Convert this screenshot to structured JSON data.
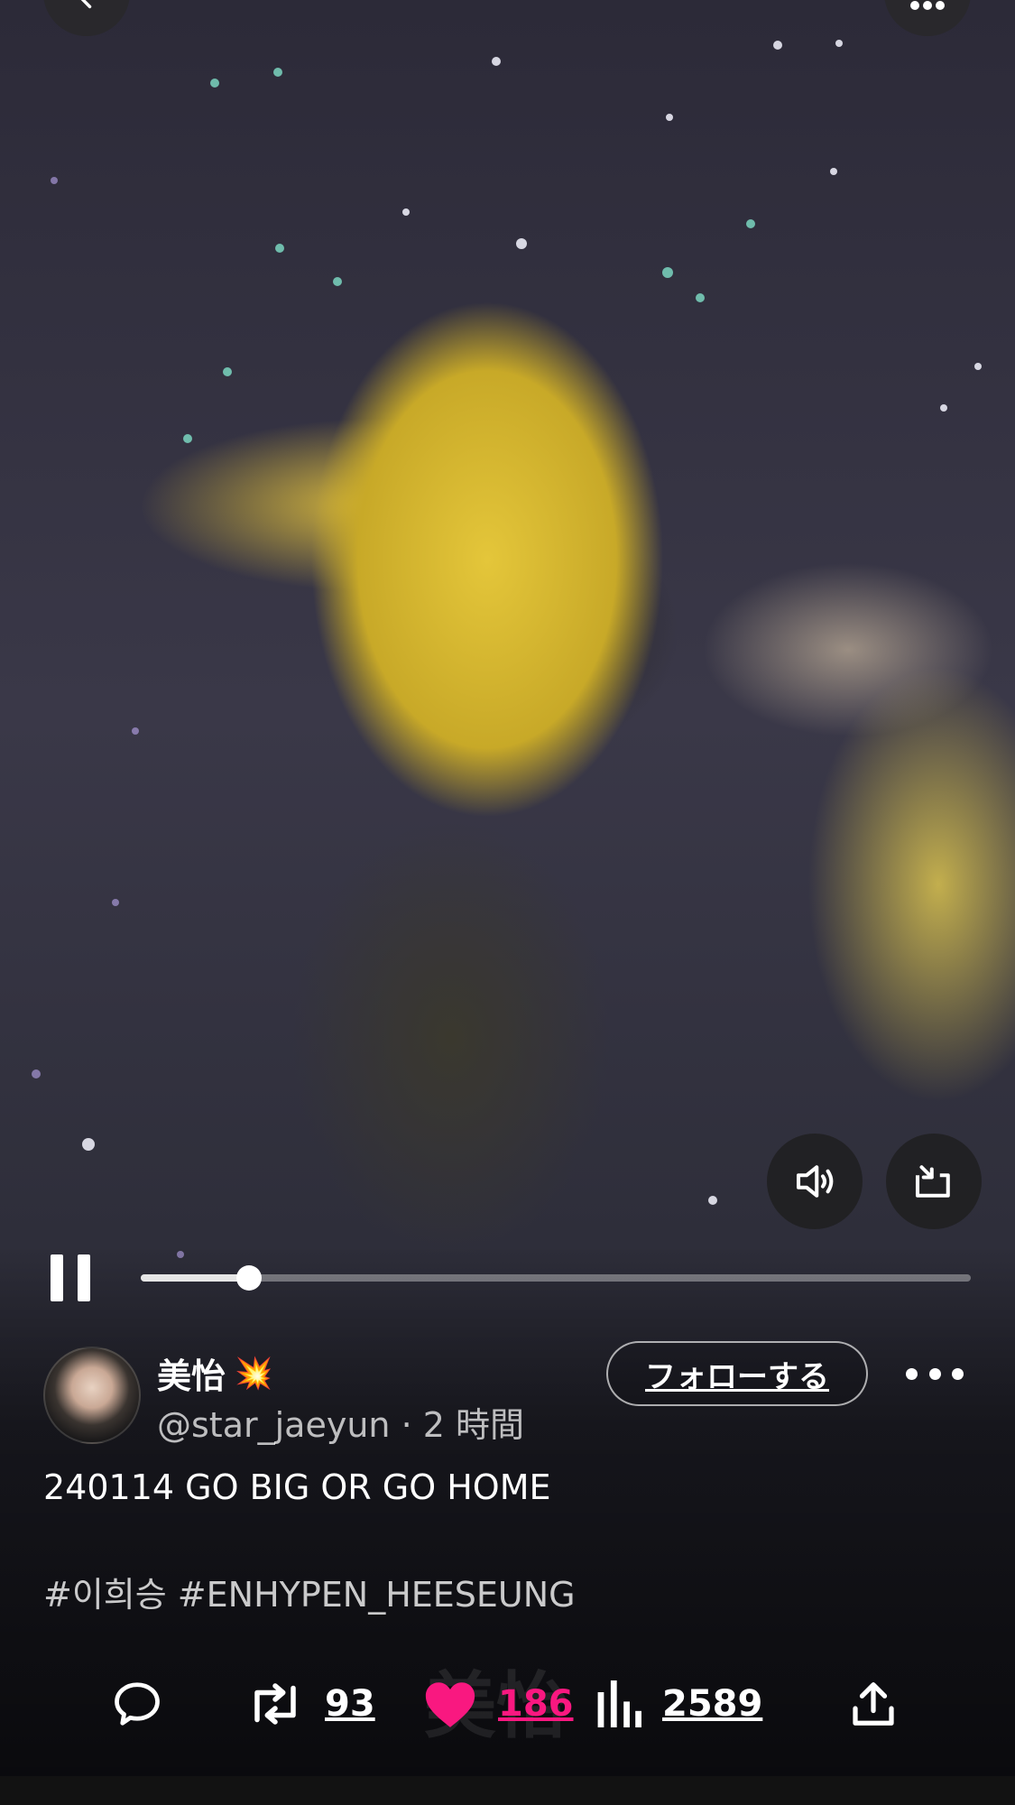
{
  "video": {
    "watermark": "美怡",
    "progress": 0.13
  },
  "controls": {
    "back_icon": "chevron-left-icon",
    "top_more_icon": "more-horizontal-icon",
    "sound_icon": "speaker-icon",
    "pip_icon": "picture-in-picture-icon",
    "pause_icon": "pause-icon"
  },
  "author": {
    "display_name": "美怡",
    "name_emoji": "💥",
    "handle_line": "@star_jaeyun · 2 時間",
    "follow_label": "フォローする"
  },
  "post": {
    "text": "240114 GO BIG OR GO HOME",
    "hashtags": "#이희승 #ENHYPEN_HEESEUNG"
  },
  "actions": {
    "reposts": "93",
    "likes": "186",
    "views": "2589"
  },
  "colors": {
    "like": "#f91880",
    "jacket": "#e4c63a"
  }
}
